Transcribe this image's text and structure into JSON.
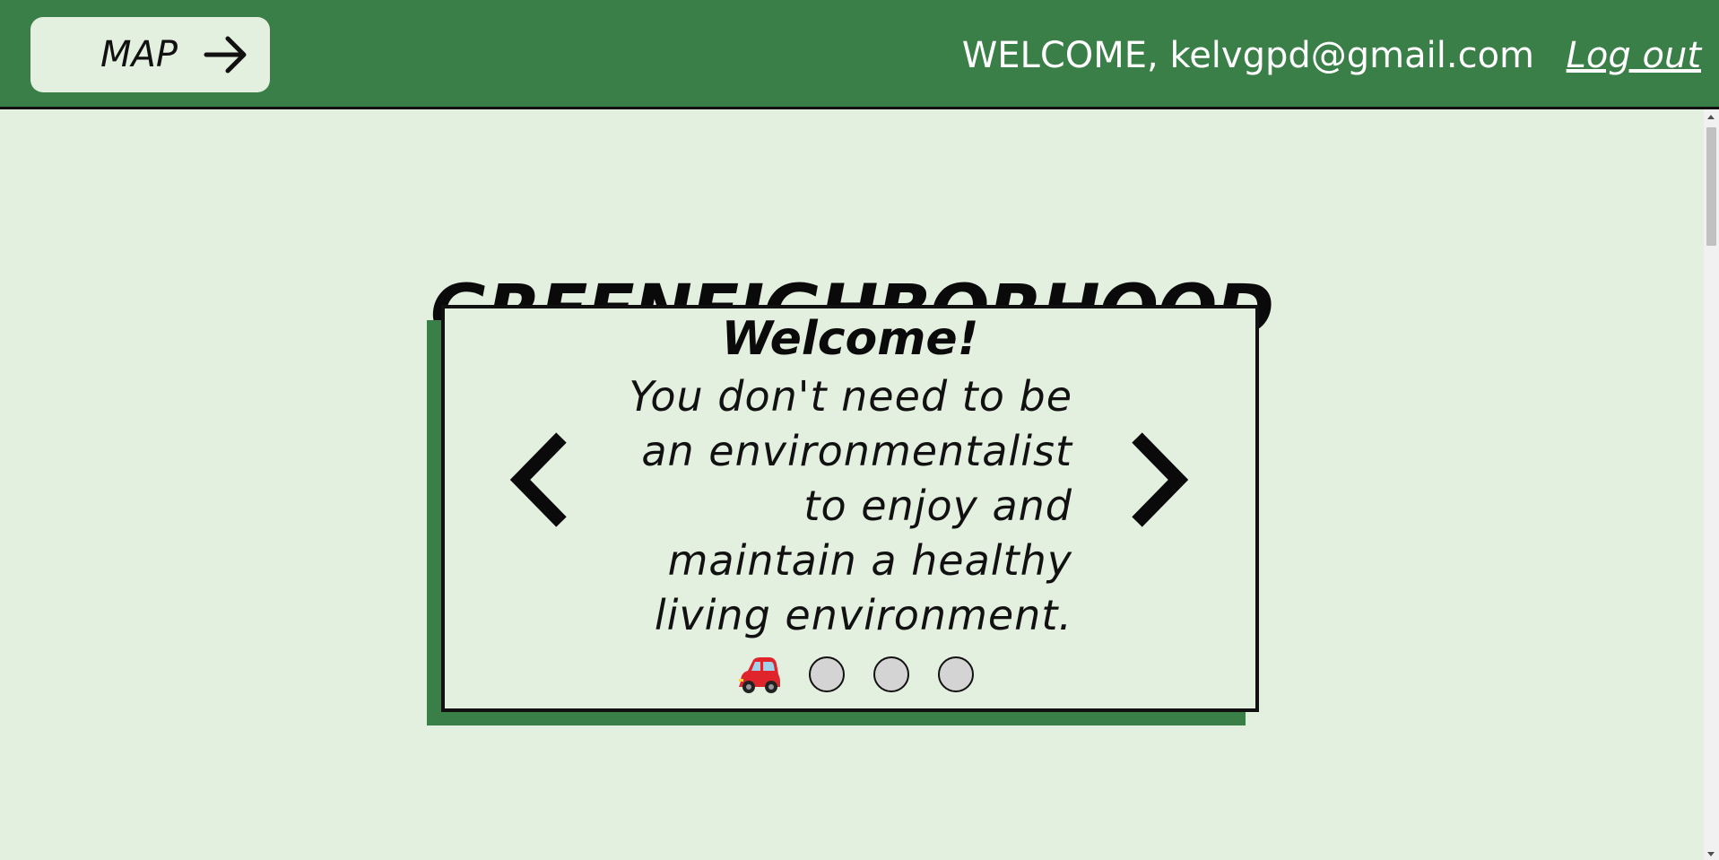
{
  "header": {
    "map_label": "MAP",
    "welcome_text": "WELCOME, kelvgpd@gmail.com",
    "logout_label": "Log out",
    "background_color": "#3a7f47"
  },
  "main": {
    "title": "GREENEIGHBORHOOD",
    "background_color": "#e3efdf"
  },
  "carousel": {
    "slide_title": "Welcome!",
    "slide_lines": [
      "You don't need to be",
      "an environmentalist",
      "to enjoy and",
      "maintain a healthy",
      "living environment."
    ],
    "active_indicator_icon": "car-icon",
    "indicator_count": 4,
    "active_index": 0,
    "prev_icon": "chevron-left-icon",
    "next_icon": "chevron-right-icon"
  }
}
